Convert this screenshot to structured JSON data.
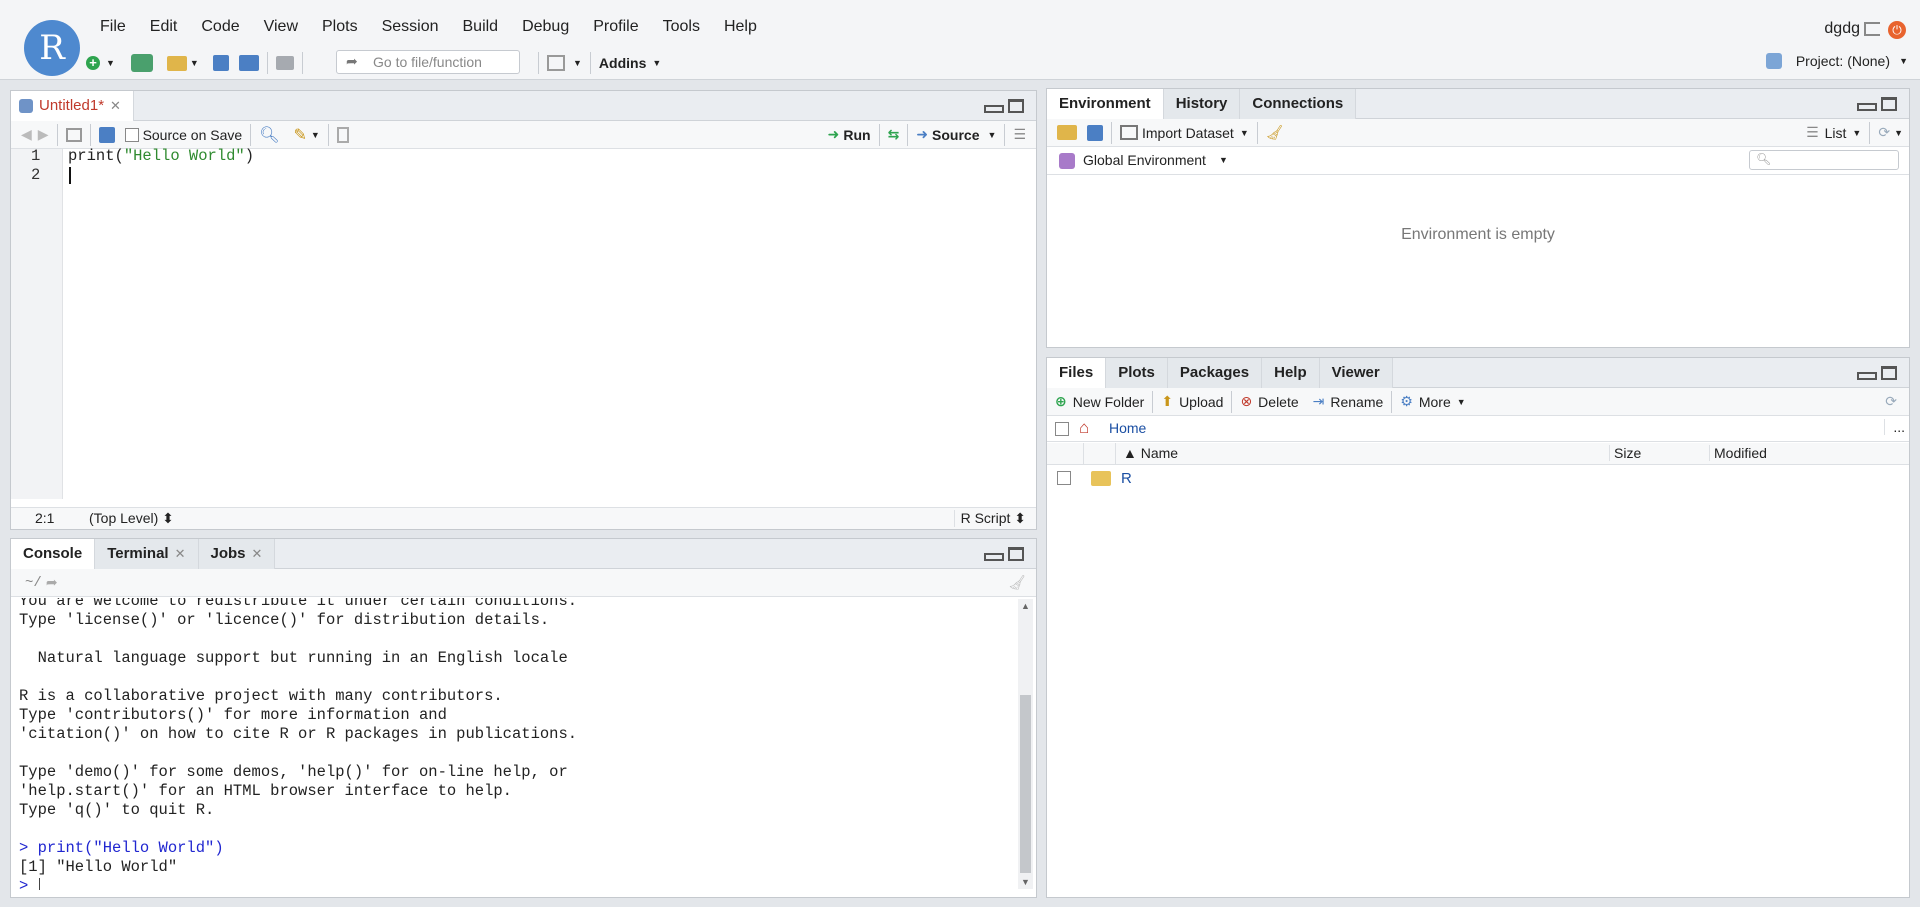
{
  "app": {
    "logo_letter": "R",
    "user": "dgdg",
    "project": "Project: (None)"
  },
  "menu": [
    "File",
    "Edit",
    "Code",
    "View",
    "Plots",
    "Session",
    "Build",
    "Debug",
    "Profile",
    "Tools",
    "Help"
  ],
  "toolbar": {
    "goto_placeholder": "Go to file/function",
    "addins": "Addins"
  },
  "editor": {
    "tab_label": "Untitled1*",
    "source_on_save": "Source on Save",
    "run": "Run",
    "source": "Source",
    "line_numbers": [
      "1",
      "2"
    ],
    "code": [
      "print(\"Hello World\")",
      ""
    ],
    "status_pos": "2:1",
    "status_scope": "(Top Level) ⬍",
    "status_type": "R Script ⬍"
  },
  "console": {
    "tabs": [
      "Console",
      "Terminal",
      "Jobs"
    ],
    "path": "~/",
    "lines": [
      "You are welcome to redistribute it under certain conditions.",
      "Type 'license()' or 'licence()' for distribution details.",
      "",
      "  Natural language support but running in an English locale",
      "",
      "R is a collaborative project with many contributors.",
      "Type 'contributors()' for more information and",
      "'citation()' on how to cite R or R packages in publications.",
      "",
      "Type 'demo()' for some demos, 'help()' for on-line help, or",
      "'help.start()' for an HTML browser interface to help.",
      "Type 'q()' to quit R.",
      ""
    ],
    "cmd": "> print(\"Hello World\")",
    "output": "[1] \"Hello World\"",
    "prompt": "> "
  },
  "environment": {
    "tabs": [
      "Environment",
      "History",
      "Connections"
    ],
    "import": "Import Dataset",
    "view_mode": "List",
    "scope": "Global Environment",
    "empty_msg": "Environment is empty"
  },
  "files": {
    "tabs": [
      "Files",
      "Plots",
      "Packages",
      "Help",
      "Viewer"
    ],
    "new_folder": "New Folder",
    "upload": "Upload",
    "delete": "Delete",
    "rename": "Rename",
    "more": "More",
    "breadcrumb": "Home",
    "ellipsis": "...",
    "columns": [
      "▲ Name",
      "Size",
      "Modified"
    ],
    "rows": [
      {
        "name": "R",
        "size": "",
        "modified": ""
      }
    ]
  },
  "colors": {
    "accent": "#4e89cf",
    "link": "#1b4fa3",
    "console_input": "#2026d0",
    "string": "#2f8a2f"
  }
}
